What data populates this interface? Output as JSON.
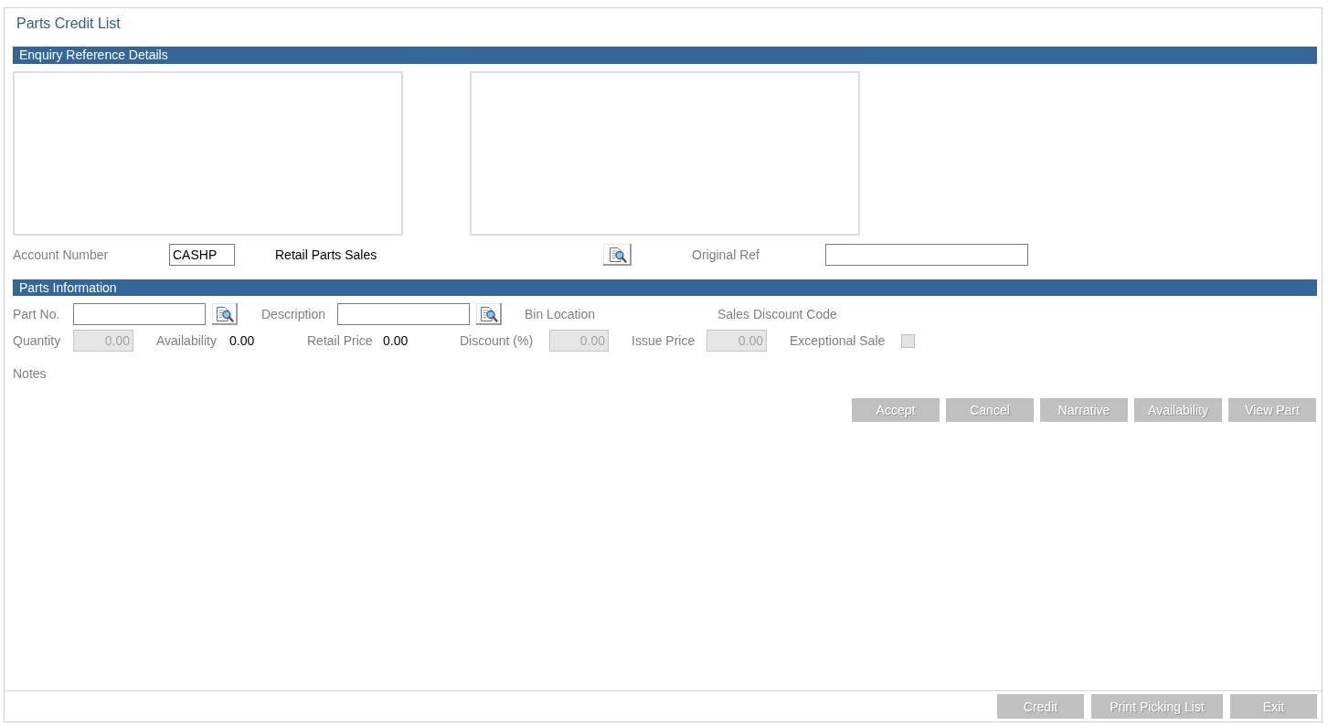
{
  "window": {
    "title": "Parts Credit List"
  },
  "enquiry_reference_details": {
    "title": "Enquiry Reference Details",
    "account_fields": [
      {
        "kind": "input",
        "label": "Account Number",
        "value": "CASHP",
        "disabled": false
      },
      {
        "kind": "text",
        "text": "Retail Parts Sales"
      },
      {
        "kind": "lookup_button"
      },
      {
        "kind": "input",
        "label": "Original Ref",
        "disabled": false
      }
    ]
  },
  "parts_information": {
    "title": "Parts Information",
    "rows": [
      {
        "fields": [
          {
            "kind": "lookup",
            "label": "Part No.",
            "disabled": false
          },
          {
            "kind": "lookup",
            "label": "Description",
            "disabled": false
          },
          {
            "kind": "label",
            "label": "Bin Location"
          },
          {
            "kind": "label",
            "label": "Sales Discount Code"
          }
        ]
      },
      {
        "fields": [
          {
            "kind": "input",
            "label": "Quantity",
            "value": "0.00",
            "disabled": true
          },
          {
            "kind": "readout",
            "label": "Availability",
            "value": "0.00"
          },
          {
            "kind": "readout",
            "label": "Retail Price",
            "value": "0.00"
          },
          {
            "kind": "input",
            "label": "Discount (%)",
            "value": "0.00",
            "disabled": true
          },
          {
            "kind": "input",
            "label": "Issue Price",
            "value": "0.00",
            "disabled": true
          },
          {
            "kind": "checkbox",
            "label": "Exceptional Sale",
            "checked": false,
            "disabled": true
          }
        ]
      },
      {
        "fields": [
          {
            "kind": "label",
            "label": "Notes"
          }
        ]
      }
    ]
  },
  "actions": [
    {
      "label": "Accept",
      "disabled": true
    },
    {
      "label": "Cancel",
      "disabled": true
    },
    {
      "label": "Narrative",
      "disabled": true
    },
    {
      "label": "Availability",
      "disabled": true
    },
    {
      "label": "View Part",
      "disabled": true
    }
  ],
  "footer_buttons": [
    {
      "label": "Credit",
      "disabled": true
    },
    {
      "label": "Print Picking List",
      "disabled": true
    },
    {
      "label": "Exit",
      "disabled": true
    }
  ]
}
